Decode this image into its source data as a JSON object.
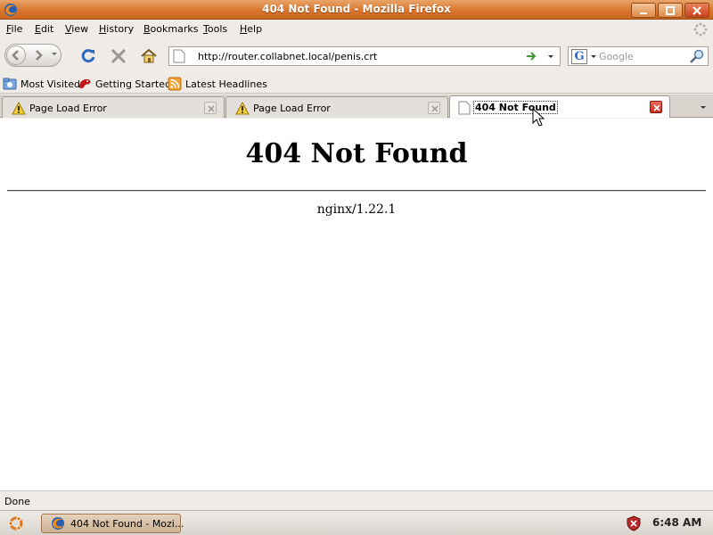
{
  "window": {
    "title": "404 Not Found - Mozilla Firefox"
  },
  "menu": {
    "items": [
      {
        "label": "File",
        "underline": "F",
        "rest": "ile"
      },
      {
        "label": "Edit",
        "underline": "E",
        "rest": "dit"
      },
      {
        "label": "View",
        "underline": "V",
        "rest": "iew"
      },
      {
        "label": "History",
        "underline": "H",
        "rest": "istory"
      },
      {
        "label": "Bookmarks",
        "underline": "B",
        "rest": "ookmarks"
      },
      {
        "label": "Tools",
        "underline": "T",
        "rest": "ools"
      },
      {
        "label": "Help",
        "underline": "H",
        "rest": "elp"
      }
    ]
  },
  "navigation": {
    "url": "http://router.collabnet.local/penis.crt",
    "search_placeholder": "Google",
    "search_engine_letter": "G"
  },
  "bookmarks": {
    "items": [
      {
        "label": "Most Visited",
        "icon": "most-visited-icon"
      },
      {
        "label": "Getting Started",
        "icon": "getting-started-icon"
      },
      {
        "label": "Latest Headlines",
        "icon": "rss-feed-icon"
      }
    ]
  },
  "tabs": [
    {
      "label": "Page Load Error",
      "icon": "warning-icon",
      "active": false
    },
    {
      "label": "Page Load Error",
      "icon": "warning-icon",
      "active": false
    },
    {
      "label": "404 Not Found",
      "icon": "page-icon",
      "active": true
    }
  ],
  "page": {
    "heading": "404 Not Found",
    "server": "nginx/1.22.1"
  },
  "status": {
    "text": "Done"
  },
  "taskbar": {
    "task_label": "404 Not Found - Mozi...",
    "clock": "6:48 AM"
  },
  "colors": {
    "titlebar": "#d9772c",
    "chrome": "#efebe7"
  }
}
